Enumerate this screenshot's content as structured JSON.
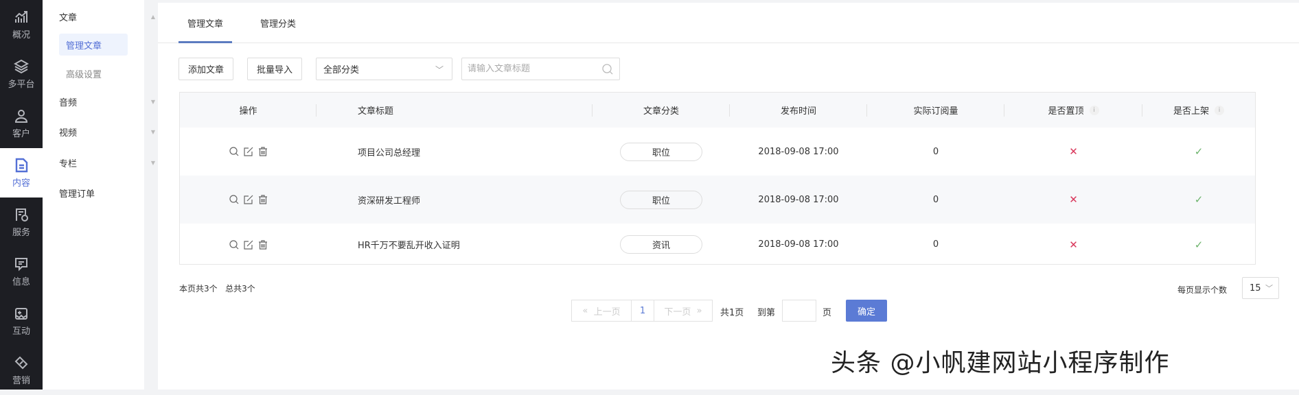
{
  "nav": [
    {
      "label": "概况",
      "icon": "chart-icon"
    },
    {
      "label": "多平台",
      "icon": "layers-icon"
    },
    {
      "label": "客户",
      "icon": "user-icon"
    },
    {
      "label": "内容",
      "icon": "document-icon",
      "active": true
    },
    {
      "label": "服务",
      "icon": "service-icon"
    },
    {
      "label": "信息",
      "icon": "message-icon"
    },
    {
      "label": "互动",
      "icon": "gamepad-icon"
    },
    {
      "label": "营销",
      "icon": "tag-icon"
    }
  ],
  "submenu": {
    "article": "文章",
    "manage_article": "管理文章",
    "advanced": "高级设置",
    "audio": "音频",
    "video": "视频",
    "column": "专栏",
    "orders": "管理订单"
  },
  "tabs": [
    "管理文章",
    "管理分类"
  ],
  "toolbar": {
    "add": "添加文章",
    "import": "批量导入",
    "category_value": "全部分类",
    "search_placeholder": "请输入文章标题"
  },
  "table": {
    "headers": [
      "操作",
      "文章标题",
      "文章分类",
      "发布时间",
      "实际订阅量",
      "是否置顶",
      "是否上架"
    ],
    "rows": [
      {
        "title": "项目公司总经理",
        "category": "职位",
        "time": "2018-09-08 17:00",
        "subs": "0",
        "top": "✕",
        "listed": "✓"
      },
      {
        "title": "资深研发工程师",
        "category": "职位",
        "time": "2018-09-08 17:00",
        "subs": "0",
        "top": "✕",
        "listed": "✓"
      },
      {
        "title": "HR千万不要乱开收入证明",
        "category": "资讯",
        "time": "2018-09-08 17:00",
        "subs": "0",
        "top": "✕",
        "listed": "✓"
      }
    ]
  },
  "footer": {
    "page_count": "本页共3个",
    "total": "总共3个",
    "prev": "上一页",
    "page": "1",
    "next": "下一页",
    "total_pages": "共1页",
    "goto": "到第",
    "page_unit": "页",
    "ok": "确定",
    "per_page_label": "每页显示个数",
    "per_page": "15"
  },
  "watermark": "头条 @小帆建网站小程序制作",
  "colors": {
    "accent": "#5b7bd5",
    "sidebar": "#1d1e23",
    "cross": "#d9375b",
    "check": "#6cb36b"
  }
}
